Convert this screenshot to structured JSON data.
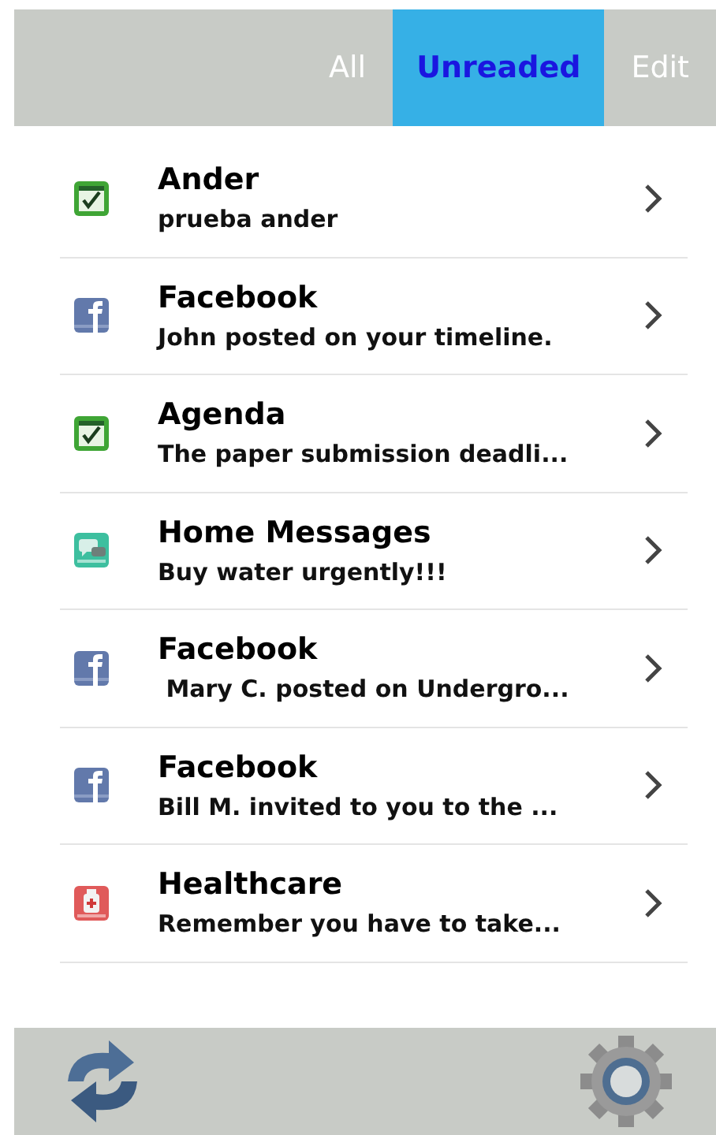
{
  "tabs": [
    {
      "label": "All",
      "selected": false
    },
    {
      "label": "Unreaded",
      "selected": true
    },
    {
      "label": "Edit",
      "selected": false
    }
  ],
  "messages": [
    {
      "kind": "calendar",
      "title": "Ander",
      "preview": "prueba ander"
    },
    {
      "kind": "facebook",
      "title": "Facebook",
      "preview": "John posted on your timeline."
    },
    {
      "kind": "calendar",
      "title": "Agenda",
      "preview": "The paper submission deadli..."
    },
    {
      "kind": "chat",
      "title": "Home Messages",
      "preview": "Buy water urgently!!!"
    },
    {
      "kind": "facebook",
      "title": "Facebook",
      "preview": " Mary C. posted on Undergro..."
    },
    {
      "kind": "facebook",
      "title": "Facebook",
      "preview": "Bill M. invited to you to the ..."
    },
    {
      "kind": "medicine",
      "title": "Healthcare",
      "preview": "Remember you have to take..."
    }
  ]
}
